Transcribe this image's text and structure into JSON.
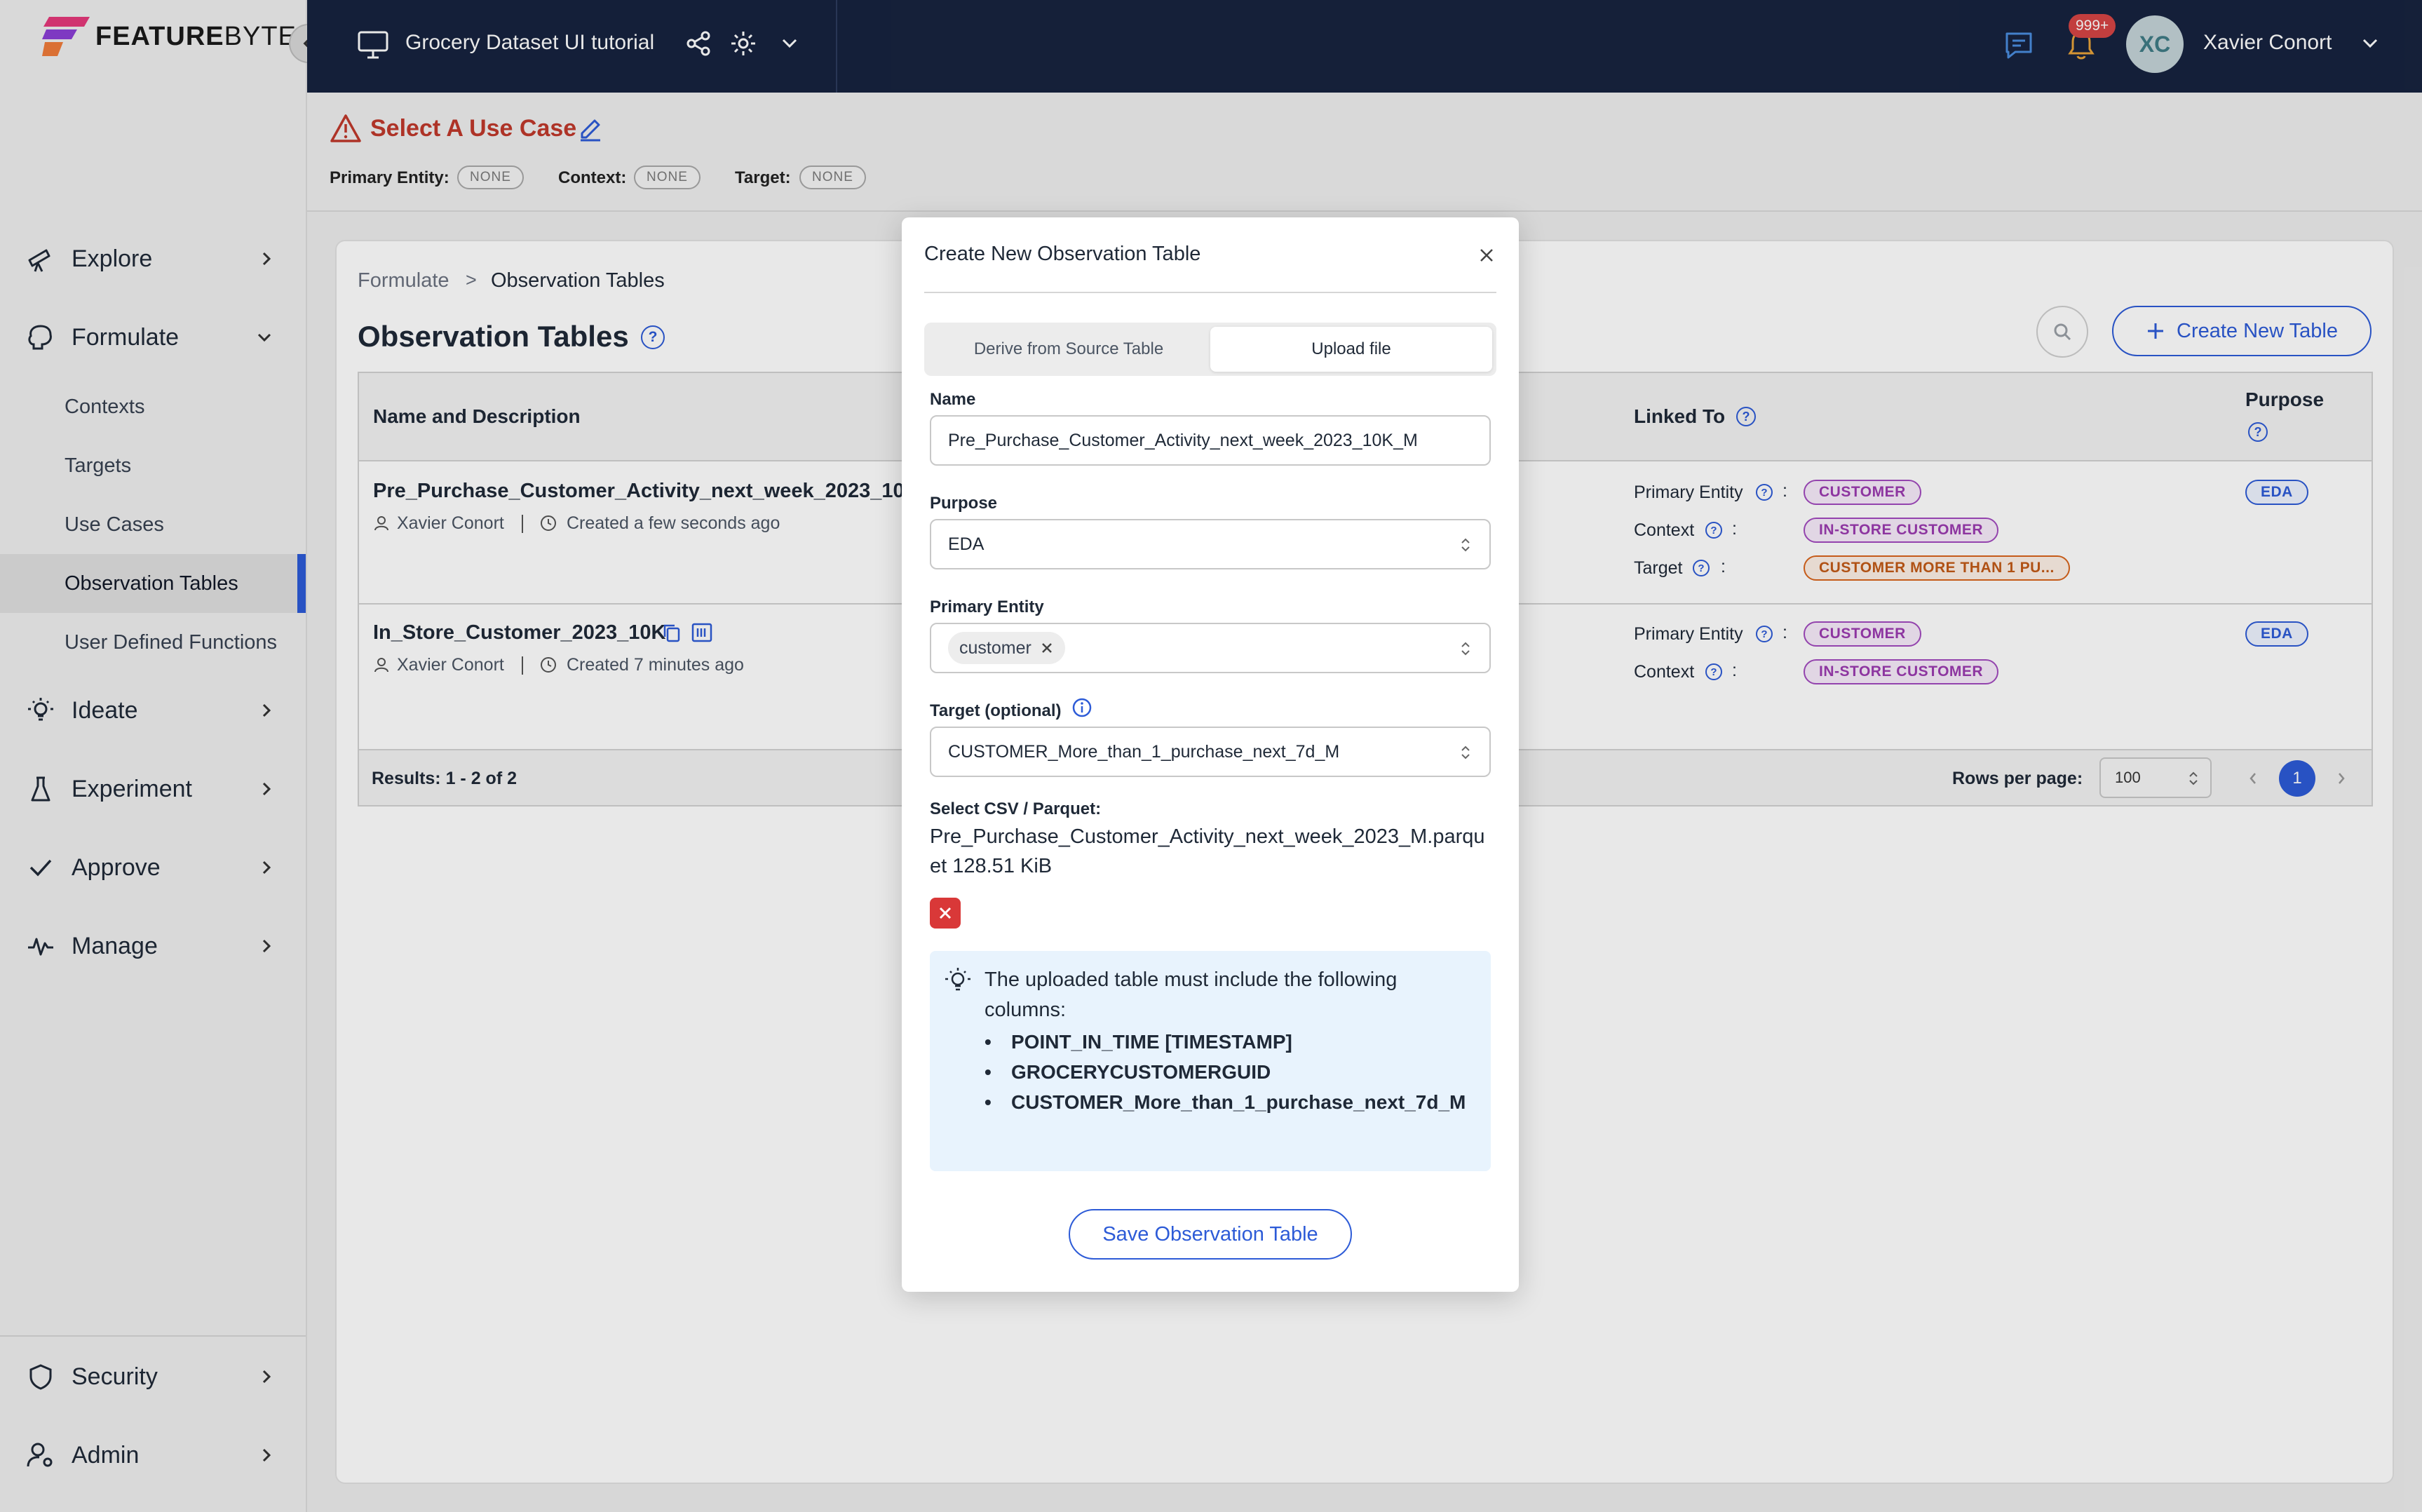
{
  "app": {
    "logo_text_bold": "FEATURE",
    "logo_text_light": "BYTE",
    "workspace_title": "Grocery Dataset UI tutorial",
    "notification_count": "999+",
    "user_initials": "XC",
    "user_name": "Xavier Conort"
  },
  "sidebar": {
    "explore": "Explore",
    "formulate": "Formulate",
    "formulate_items": [
      "Contexts",
      "Targets",
      "Use Cases",
      "Observation Tables",
      "User Defined Functions"
    ],
    "ideate": "Ideate",
    "experiment": "Experiment",
    "approve": "Approve",
    "manage": "Manage",
    "security": "Security",
    "admin": "Admin"
  },
  "use_case": {
    "title": "Select A Use Case",
    "primary_entity_label": "Primary Entity:",
    "context_label": "Context:",
    "target_label": "Target:",
    "none": "NONE"
  },
  "page": {
    "breadcrumb_root": "Formulate",
    "breadcrumb_sep": ">",
    "breadcrumb_current": "Observation Tables",
    "title": "Observation Tables",
    "create_button": "Create New Table",
    "columns": {
      "name": "Name and Description",
      "linked": "Linked To",
      "purpose": "Purpose"
    },
    "rows": [
      {
        "name": "Pre_Purchase_Customer_Activity_next_week_2023_10K",
        "author": "Xavier Conort",
        "created": "Created a few seconds ago",
        "primary_entity_label": "Primary Entity",
        "primary_entity": "CUSTOMER",
        "context_label": "Context",
        "context": "IN-STORE CUSTOMER",
        "target_label": "Target",
        "target": "CUSTOMER MORE THAN 1 PU...",
        "purpose": "EDA"
      },
      {
        "name": "In_Store_Customer_2023_10K",
        "author": "Xavier Conort",
        "created": "Created 7 minutes ago",
        "primary_entity_label": "Primary Entity",
        "primary_entity": "CUSTOMER",
        "context_label": "Context",
        "context": "IN-STORE CUSTOMER",
        "purpose": "EDA"
      }
    ],
    "colon": ":",
    "results": "Results: 1 - 2 of 2",
    "rows_per_page_label": "Rows per page:",
    "rows_per_page_value": "100",
    "current_page": "1"
  },
  "modal": {
    "title": "Create New Observation Table",
    "tab_derive": "Derive from Source Table",
    "tab_upload": "Upload file",
    "name_label": "Name",
    "name_value": "Pre_Purchase_Customer_Activity_next_week_2023_10K_M",
    "purpose_label": "Purpose",
    "purpose_value": "EDA",
    "primary_entity_label": "Primary Entity",
    "primary_entity_tag": "customer",
    "target_label": "Target (optional)",
    "target_value": "CUSTOMER_More_than_1_purchase_next_7d_M",
    "file_label": "Select CSV / Parquet:",
    "file_name": "Pre_Purchase_Customer_Activity_next_week_2023_M.parquet 128.51 KiB",
    "info_text": "The uploaded table must include the following columns:",
    "required_columns": [
      "POINT_IN_TIME [TIMESTAMP]",
      "GROCERYCUSTOMERGUID",
      "CUSTOMER_More_than_1_purchase_next_7d_M"
    ],
    "save_button": "Save Observation Table"
  },
  "colors": {
    "brand_blue": "#2d5bd7",
    "topbar": "#17233f",
    "warning_red": "#c0392b",
    "chip_purple": "#a24abf",
    "chip_orange": "#d9651c",
    "info_bg": "#e8f3fd"
  }
}
